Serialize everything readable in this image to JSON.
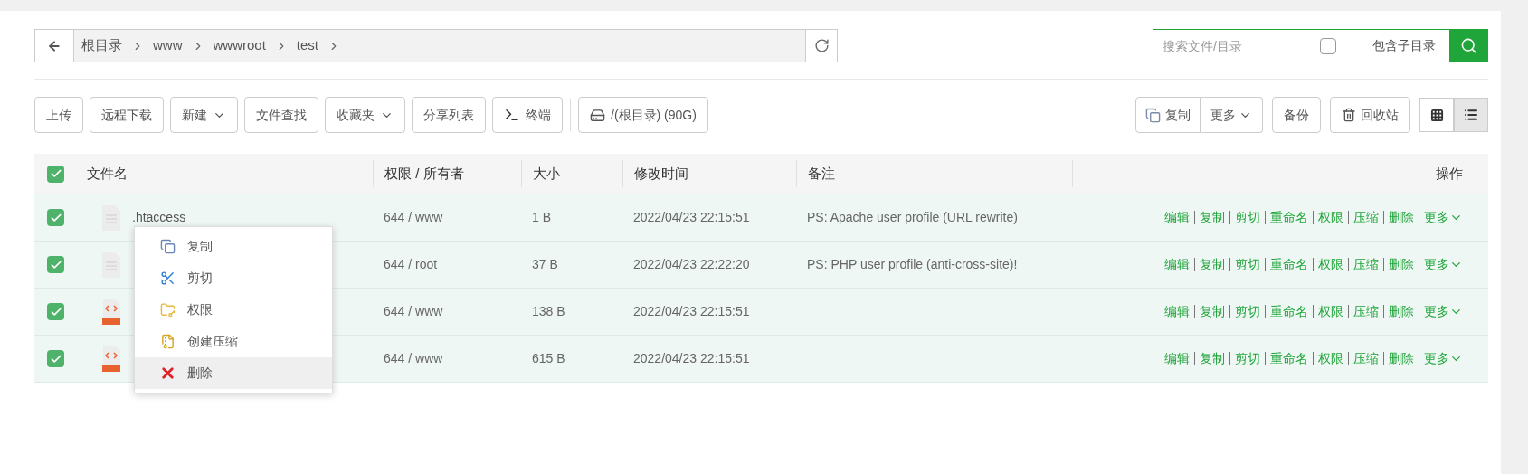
{
  "breadcrumb": {
    "items": [
      "根目录",
      "www",
      "wwwroot",
      "test"
    ]
  },
  "search": {
    "placeholder": "搜索文件/目录",
    "include_label": "包含子目录",
    "include_checked": false
  },
  "toolbar": {
    "left": [
      {
        "label": "上传",
        "kind": "plain"
      },
      {
        "label": "远程下载",
        "kind": "plain"
      },
      {
        "label": "新建",
        "kind": "dropdown"
      },
      {
        "label": "文件查找",
        "kind": "plain"
      },
      {
        "label": "收藏夹",
        "kind": "dropdown"
      },
      {
        "label": "分享列表",
        "kind": "plain"
      },
      {
        "label": "终端",
        "kind": "terminal"
      },
      {
        "label": "/(根目录) (90G)",
        "kind": "disk"
      }
    ],
    "copy": "复制",
    "more": "更多",
    "backup": "备份",
    "recycle": "回收站",
    "views": [
      {
        "kind": "grid",
        "selected": false
      },
      {
        "kind": "list",
        "selected": true
      }
    ]
  },
  "table": {
    "all_checked": true,
    "columns": [
      "文件名",
      "权限 / 所有者",
      "大小",
      "修改时间",
      "备注",
      "操作"
    ],
    "rows": [
      {
        "checked": true,
        "kind": "text",
        "name": ".htaccess",
        "owner": "644 / www",
        "size": "1 B",
        "modified": "2022/04/23 22:15:51",
        "note": "PS: Apache user profile (URL rewrite)",
        "actions": [
          "编辑",
          "复制",
          "剪切",
          "重命名",
          "权限",
          "压缩",
          "删除",
          "更多"
        ]
      },
      {
        "checked": true,
        "kind": "text",
        "owner": "644 / root",
        "size": "37 B",
        "modified": "2022/04/23 22:22:20",
        "note": "PS: PHP user profile (anti-cross-site)!",
        "actions": [
          "编辑",
          "复制",
          "剪切",
          "重命名",
          "权限",
          "压缩",
          "删除",
          "更多"
        ]
      },
      {
        "checked": true,
        "kind": "html",
        "owner": "644 / www",
        "size": "138 B",
        "modified": "2022/04/23 22:15:51",
        "actions": [
          "编辑",
          "复制",
          "剪切",
          "重命名",
          "权限",
          "压缩",
          "删除",
          "更多"
        ]
      },
      {
        "checked": true,
        "kind": "html",
        "owner": "644 / www",
        "size": "615 B",
        "modified": "2022/04/23 22:15:51",
        "actions": [
          "编辑",
          "复制",
          "剪切",
          "重命名",
          "权限",
          "压缩",
          "删除",
          "更多"
        ]
      }
    ]
  },
  "context_menu": {
    "items": [
      {
        "label": "复制",
        "kind": "copy",
        "selected": false
      },
      {
        "label": "剪切",
        "kind": "cut",
        "selected": false
      },
      {
        "label": "权限",
        "kind": "permission",
        "selected": false
      },
      {
        "label": "创建压缩",
        "kind": "zip",
        "selected": false
      },
      {
        "label": "删除",
        "kind": "delete",
        "selected": true
      }
    ]
  }
}
